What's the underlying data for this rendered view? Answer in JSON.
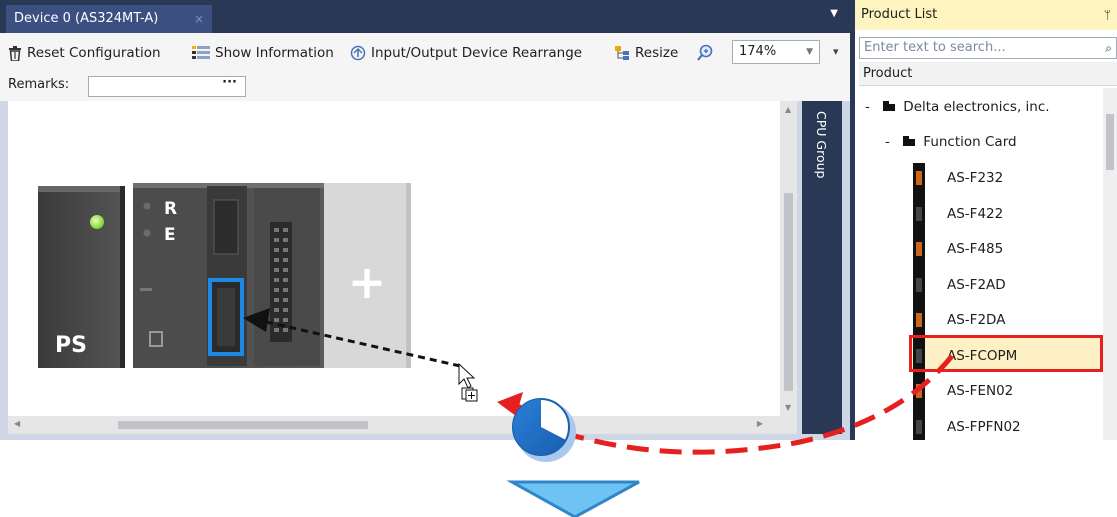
{
  "tab": {
    "title": "Device 0 (AS324MT-A)",
    "close": "×",
    "menu": "▼"
  },
  "toolbar": {
    "reset_label": "Reset Configuration",
    "show_info_label": "Show Information",
    "io_rearrange_label": "Input/Output Device Rearrange",
    "resize_label": "Resize",
    "zoom_value": "174%",
    "overflow": "▾"
  },
  "remarks": {
    "label": "Remarks:",
    "value": "",
    "browse": "···"
  },
  "cpu_group": {
    "label": "CPU Group"
  },
  "hardware": {
    "ps_label": "PS",
    "led_r": "R",
    "led_e": "E",
    "add_slot": "+"
  },
  "product_list": {
    "title": "Product List",
    "pin": "🖈",
    "search_placeholder": "Enter text to search...",
    "column_header": "Product",
    "vendor": {
      "expander": "-",
      "label": "Delta electronics, inc."
    },
    "category": {
      "expander": "-",
      "label": "Function Card"
    },
    "items": [
      {
        "label": "AS-F232"
      },
      {
        "label": "AS-F422"
      },
      {
        "label": "AS-F485"
      },
      {
        "label": "AS-F2AD"
      },
      {
        "label": "AS-F2DA"
      },
      {
        "label": "AS-FCOPM",
        "highlighted": true
      },
      {
        "label": "AS-FEN02"
      },
      {
        "label": "AS-FPFN02"
      }
    ]
  },
  "colors": {
    "title_bar": "#293955",
    "tab_active": "#3b4f81",
    "highlight_border": "#e5201e",
    "highlight_fill": "#fdf0c5",
    "slot_border": "#1e88e5",
    "led_green": "#7bd22c",
    "arrow_blue": "#6fc3f2"
  }
}
